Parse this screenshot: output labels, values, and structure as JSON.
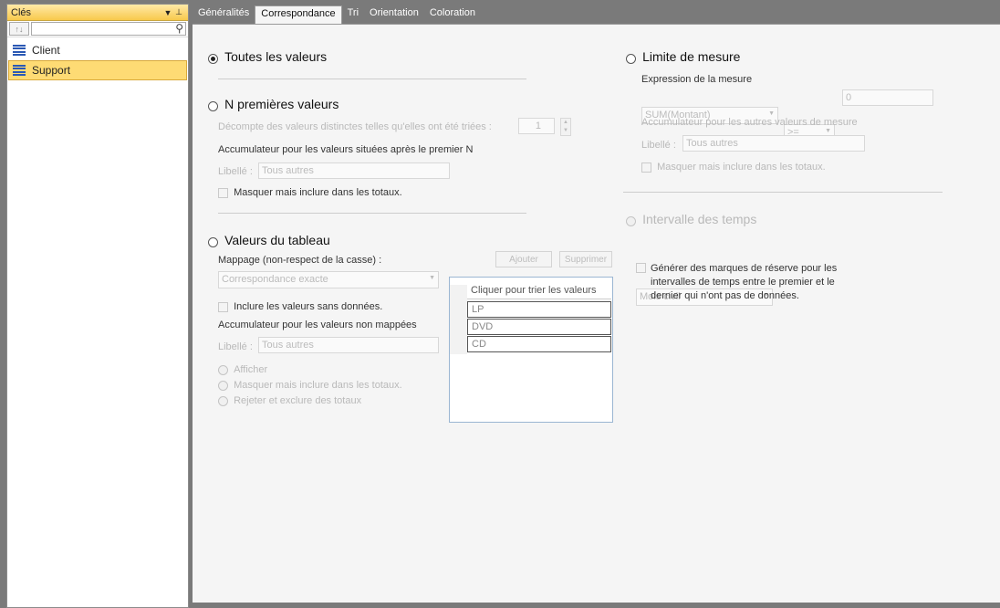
{
  "left_panel": {
    "title": "Clés",
    "items": [
      "Client",
      "Support"
    ],
    "selected": "Support"
  },
  "tabs": [
    "Généralités",
    "Correspondance",
    "Tri",
    "Orientation",
    "Coloration"
  ],
  "active_tab": "Correspondance",
  "sections": {
    "toutes": {
      "label": "Toutes les valeurs"
    },
    "npremieres": {
      "label": "N premières valeurs",
      "count_label": "Décompte des valeurs distinctes telles qu'elles ont été triées :",
      "count_value": "1",
      "accum_label": "Accumulateur pour les valeurs situées après le premier N",
      "libelle_label": "Libellé :",
      "libelle_value": "Tous autres",
      "hide_label": "Masquer mais inclure dans les totaux."
    },
    "tableau": {
      "label": "Valeurs du tableau",
      "mapping_label": "Mappage (non-respect de la casse) :",
      "add_label": "Ajouter",
      "remove_label": "Supprimer",
      "match_value": "Correspondance exacte",
      "include_label": "Inclure les valeurs sans données.",
      "accum_label": "Accumulateur pour les valeurs non mappées",
      "libelle_label": "Libellé :",
      "libelle_value": "Tous autres",
      "opt_show": "Afficher",
      "opt_hide": "Masquer mais inclure dans les totaux.",
      "opt_reject": "Rejeter et exclure des totaux",
      "list_header": "Cliquer pour trier les valeurs",
      "list_values": [
        "LP",
        "DVD",
        "CD"
      ]
    },
    "limite": {
      "label": "Limite de mesure",
      "expr_label": "Expression de la mesure",
      "measure_value": "SUM(Montant)",
      "operator_value": ">=",
      "threshold_value": "0",
      "accum_label": "Accumulateur pour les autres valeurs de mesure",
      "libelle_label": "Libellé :",
      "libelle_value": "Tous autres",
      "hide_label": "Masquer mais inclure dans les totaux."
    },
    "intervalle": {
      "label": "Intervalle des temps",
      "period_value": "Mois civil",
      "generate_label": "Générer des marques de réserve pour les intervalles de temps entre le premier et le dernier qui n'ont pas de données."
    }
  }
}
